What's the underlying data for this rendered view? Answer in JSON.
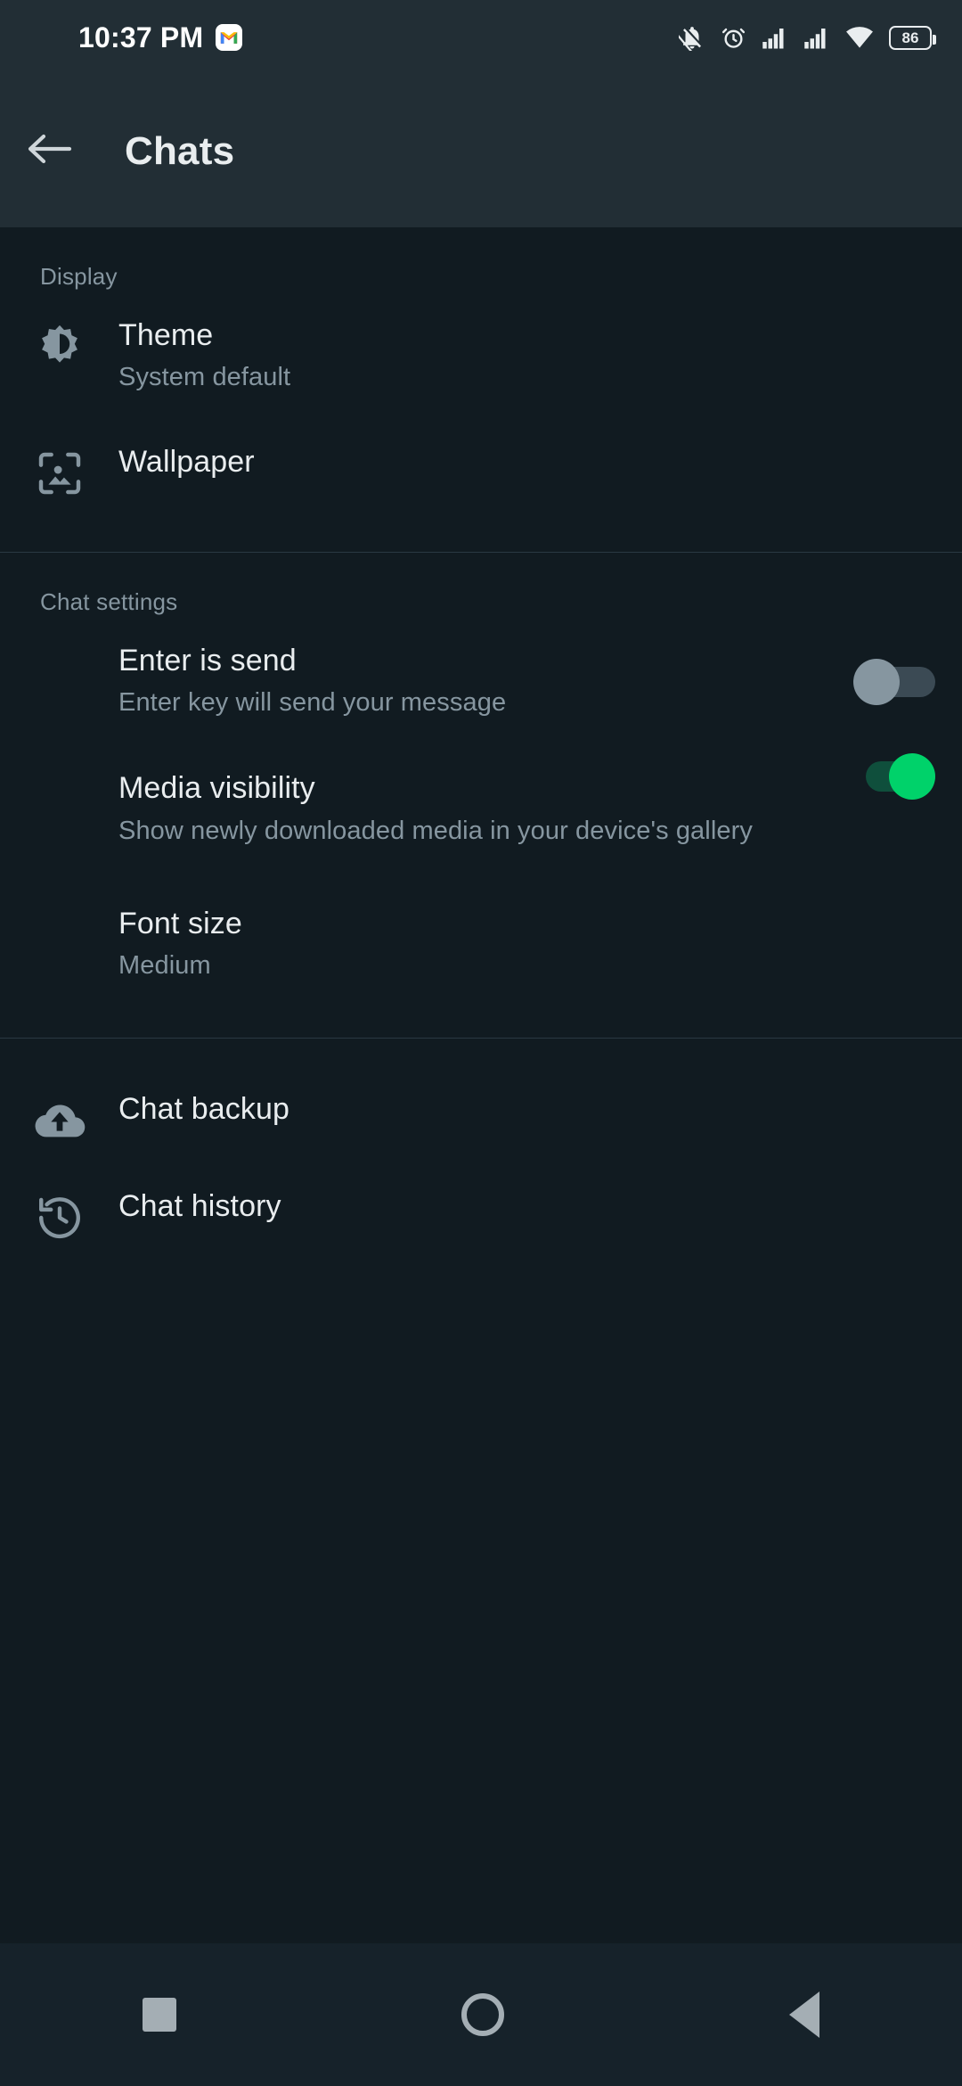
{
  "status_bar": {
    "time": "10:37 PM",
    "battery_percent": "86",
    "icons": [
      "gmail-icon",
      "notifications-off-icon",
      "alarm-icon",
      "signal-bars-icon",
      "signal-bars-icon",
      "wifi-icon",
      "battery-icon"
    ]
  },
  "toolbar": {
    "title": "Chats",
    "back_icon": "back-arrow-icon"
  },
  "sections": [
    {
      "header": "Display",
      "rows": [
        {
          "icon": "brightness-theme-icon",
          "title": "Theme",
          "subtitle": "System default"
        },
        {
          "icon": "wallpaper-image-icon",
          "title": "Wallpaper",
          "subtitle": ""
        }
      ]
    },
    {
      "header": "Chat settings",
      "rows": [
        {
          "icon": "",
          "title": "Enter is send",
          "subtitle": "Enter key will send your message",
          "toggle": "off"
        },
        {
          "icon": "",
          "title": "Media visibility",
          "subtitle": "Show newly downloaded media in your device's gallery",
          "toggle": "on"
        },
        {
          "icon": "",
          "title": "Font size",
          "subtitle": "Medium"
        }
      ]
    },
    {
      "header": "",
      "rows": [
        {
          "icon": "cloud-upload-icon",
          "title": "Chat backup",
          "subtitle": ""
        },
        {
          "icon": "history-clock-icon",
          "title": "Chat history",
          "subtitle": ""
        }
      ]
    }
  ],
  "nav_bar": {
    "recents_label": "recents-square",
    "home_label": "home-circle",
    "back_label": "back-triangle"
  },
  "colors": {
    "background": "#111b21",
    "toolbar": "#222e35",
    "primary_text": "#e9edef",
    "secondary_text": "#8696a0",
    "accent_green": "#00d26a",
    "divider": "#2a3942"
  }
}
